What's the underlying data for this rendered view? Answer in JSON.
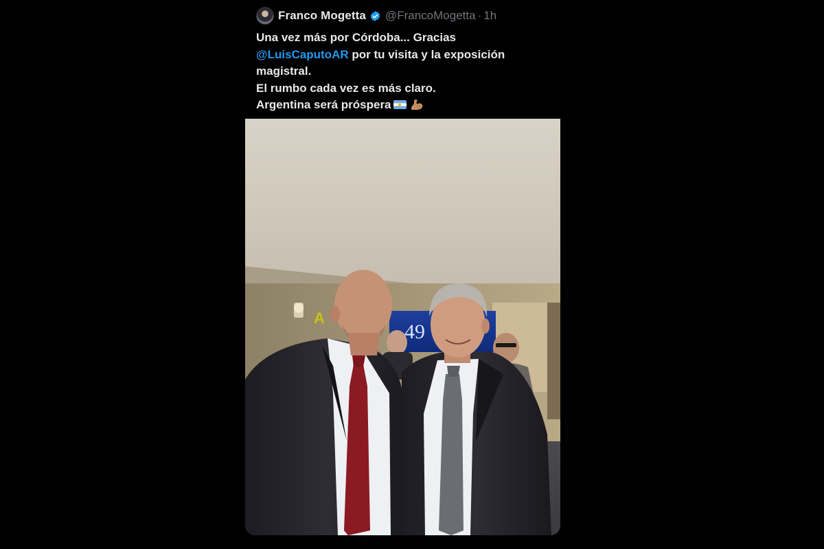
{
  "tweet": {
    "author": {
      "display_name": "Franco Mogetta",
      "handle": "@FrancoMogetta",
      "verified": true,
      "avatar_icon": "avatar"
    },
    "separator": "·",
    "timestamp": "1h",
    "text": {
      "line1": "Una vez más por Córdoba... Gracias",
      "mention": "@LuisCaputoAR",
      "line2_rest": " por tu visita y la exposición",
      "line3": "magistral.",
      "line4": "El rumbo cada vez es más claro.",
      "line5": "Argentina será próspera"
    },
    "emoji_icons": [
      "argentina-flag-icon",
      "flexed-biceps-icon"
    ],
    "media": {
      "kind": "photo",
      "background_sign_letter": "A",
      "screen_text": "49"
    }
  },
  "colors": {
    "background": "#000000",
    "text_primary": "#e7e9ea",
    "text_secondary": "#71767b",
    "link": "#1d9bf0",
    "verified_badge": "#1d9bf0"
  }
}
